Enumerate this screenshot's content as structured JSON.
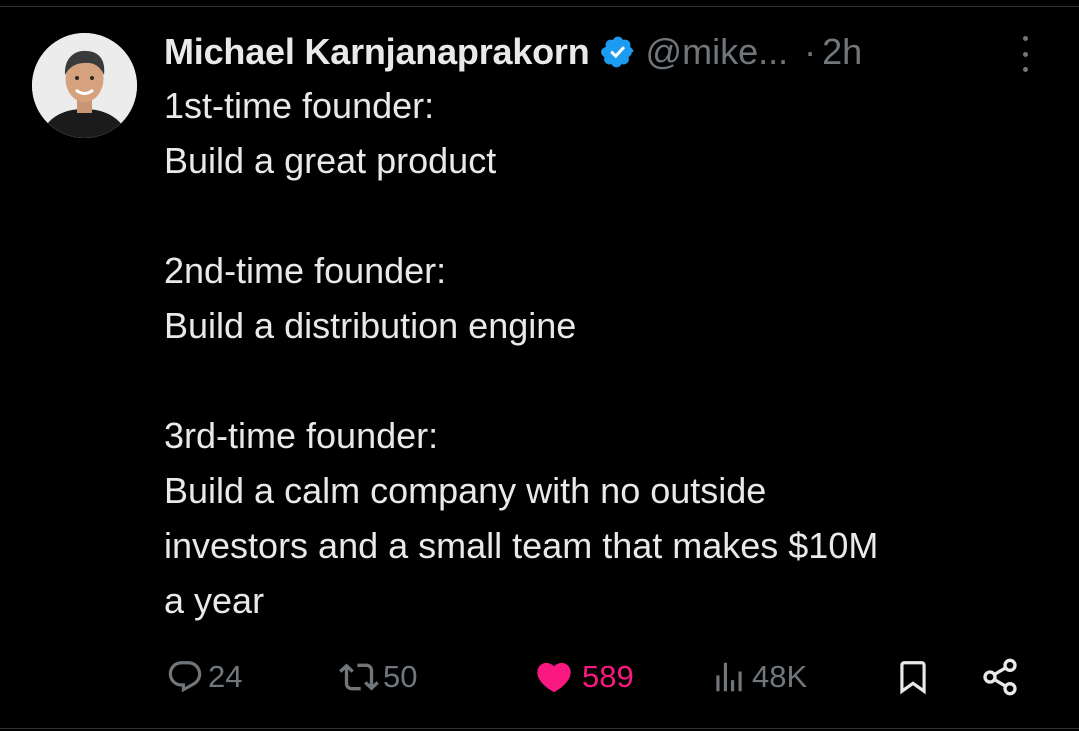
{
  "author": {
    "display_name": "Michael Karnjanaprakorn",
    "handle": "@mike...",
    "separator": "·",
    "time": "2h",
    "verified_icon": "verified-badge-icon",
    "verified_color": "#1d9bf0"
  },
  "tweet": {
    "paragraphs": [
      [
        "1st-time founder:",
        "Build a great product"
      ],
      [
        "2nd-time founder:",
        "Build a distribution engine"
      ],
      [
        "3rd-time founder:",
        "Build a calm company with no outside",
        "investors and a small team that makes $10M",
        "a year"
      ]
    ]
  },
  "actions": {
    "reply": {
      "icon": "reply-icon",
      "count": "24"
    },
    "repost": {
      "icon": "repost-icon",
      "count": "50"
    },
    "like": {
      "icon": "heart-icon",
      "count": "589",
      "color": "#f91880"
    },
    "views": {
      "icon": "views-icon",
      "count": "48K"
    },
    "bookmark": {
      "icon": "bookmark-icon"
    },
    "share": {
      "icon": "share-icon"
    }
  },
  "colors": {
    "background": "#000000",
    "text": "#e7e9ea",
    "muted": "#71767b"
  }
}
